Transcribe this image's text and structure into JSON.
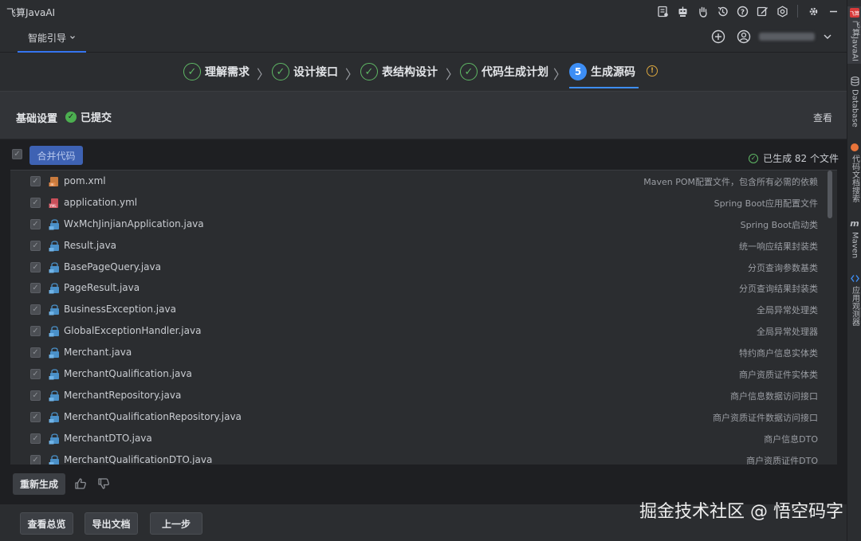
{
  "window": {
    "title": "飞算JavaAI"
  },
  "toolbar_icons": [
    "file-report-icon",
    "robot-icon",
    "hand-icon",
    "history-icon",
    "help-icon",
    "edit-icon",
    "shield-icon",
    "settings-icon",
    "minimize-icon"
  ],
  "mode_tab": {
    "label": "智能引导"
  },
  "steps": [
    {
      "label": "理解需求",
      "state": "done"
    },
    {
      "label": "设计接口",
      "state": "done"
    },
    {
      "label": "表结构设计",
      "state": "done"
    },
    {
      "label": "代码生成计划",
      "state": "done"
    },
    {
      "label": "生成源码",
      "state": "active",
      "number": "5"
    }
  ],
  "basic": {
    "label": "基础设置",
    "status": "已提交",
    "view": "查看"
  },
  "merge": {
    "button": "合并代码",
    "generated": "已生成 82 个文件"
  },
  "files": [
    {
      "name": "pom.xml",
      "desc": "Maven POM配置文件，包含所有必需的依赖",
      "icon": "xml"
    },
    {
      "name": "application.yml",
      "desc": "Spring Boot应用配置文件",
      "icon": "yml"
    },
    {
      "name": "WxMchJinjianApplication.java",
      "desc": "Spring Boot启动类",
      "icon": "java"
    },
    {
      "name": "Result.java",
      "desc": "统一响应结果封装类",
      "icon": "java"
    },
    {
      "name": "BasePageQuery.java",
      "desc": "分页查询参数基类",
      "icon": "java"
    },
    {
      "name": "PageResult.java",
      "desc": "分页查询结果封装类",
      "icon": "java"
    },
    {
      "name": "BusinessException.java",
      "desc": "全局异常处理类",
      "icon": "java"
    },
    {
      "name": "GlobalExceptionHandler.java",
      "desc": "全局异常处理器",
      "icon": "java"
    },
    {
      "name": "Merchant.java",
      "desc": "特约商户信息实体类",
      "icon": "java"
    },
    {
      "name": "MerchantQualification.java",
      "desc": "商户资质证件实体类",
      "icon": "java"
    },
    {
      "name": "MerchantRepository.java",
      "desc": "商户信息数据访问接口",
      "icon": "java"
    },
    {
      "name": "MerchantQualificationRepository.java",
      "desc": "商户资质证件数据访问接口",
      "icon": "java"
    },
    {
      "name": "MerchantDTO.java",
      "desc": "商户信息DTO",
      "icon": "java"
    },
    {
      "name": "MerchantQualificationDTO.java",
      "desc": "商户资质证件DTO",
      "icon": "java"
    }
  ],
  "actions": {
    "regenerate": "重新生成"
  },
  "bottom": {
    "overview": "查看总览",
    "export": "导出文档",
    "prev": "上一步"
  },
  "watermark": "掘金技术社区 @ 悟空码字",
  "right_tools": [
    {
      "label": "飞算JavaAI",
      "badge": "飞算",
      "color": "#d83a3a"
    },
    {
      "label": "Database",
      "badge": "",
      "color": ""
    },
    {
      "label": "代码文档搜索",
      "badge": "",
      "color": "#e8743a"
    },
    {
      "label": "Maven",
      "badge": "m",
      "color": ""
    },
    {
      "label": "应用观测器",
      "badge": "",
      "color": "#3d8ef5"
    }
  ],
  "colors": {
    "accent": "#3d8ef5",
    "success": "#5fb865",
    "merge_button": "#3e62b3",
    "warning": "#d9a53f"
  }
}
